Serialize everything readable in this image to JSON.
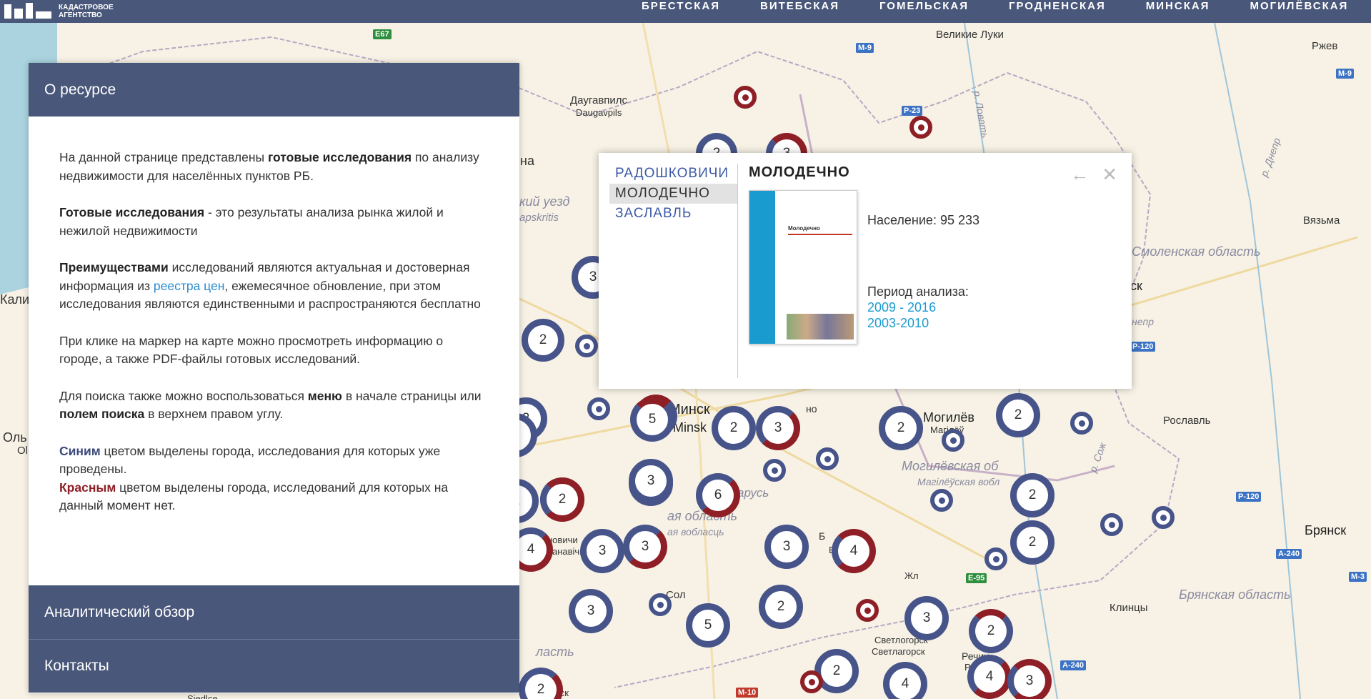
{
  "header": {
    "logo_text_line1": "КАДАСТРОВОЕ",
    "logo_text_line2": "АГЕНТСТВО",
    "nav": [
      "БРЕСТСКАЯ",
      "ВИТЕБСКАЯ",
      "ГОМЕЛЬСКАЯ",
      "ГРОДНЕНСКАЯ",
      "МИНСКАЯ",
      "МОГИЛЁВСКАЯ"
    ]
  },
  "panel": {
    "about_title": "О ресурсе",
    "p1_a": "На данной странице представлены ",
    "p1_b": "готовые исследования",
    "p1_c": " по анализу недвижимости для населённых пунктов РБ.",
    "p2_a": "Готовые исследования",
    "p2_b": " - это результаты анализа рынка жилой и нежилой недвижимости",
    "p3_a": "Преимуществами",
    "p3_b": " исследований являются актуальная и достоверная информация из ",
    "p3_link": "реестра цен",
    "p3_c": ", ежемесячное обновление, при этом исследования являются единственными и распространяются бесплатно",
    "p4": "При клике на маркер на карте можно просмотреть информацию о городе, а также PDF-файлы готовых исследований.",
    "p5_a": "Для поиска также можно воспользоваться ",
    "p5_b": "меню",
    "p5_c": " в начале страницы или ",
    "p5_d": "полем поиска",
    "p5_e": " в верхнем правом углу.",
    "p6_a": "Синим",
    "p6_b": " цветом выделены города, исследования для которых уже проведены.",
    "p6_c": "Красным",
    "p6_d": " цветом выделены города, исследований для которых на данный момент нет.",
    "analytics_title": "Аналитический обзор",
    "contacts_title": "Контакты"
  },
  "popup": {
    "cities": [
      "РАДОШКОВИЧИ",
      "МОЛОДЕЧНО",
      "ЗАСЛАВЛЬ"
    ],
    "active_city": "МОЛОДЕЧНО",
    "title": "МОЛОДЕЧНО",
    "doc_title": "Молодечно",
    "population": "Население: 95 233",
    "period_label": "Период анализа:",
    "periods": [
      "2009 - 2016",
      "2003-2010"
    ],
    "back_icon": "←",
    "close_icon": "✕"
  },
  "map": {
    "labels": {
      "velikie_luki": "Великие Луки",
      "rzhev": "Ржев",
      "daugavpils1": "Даугавпилс",
      "daugavpils2": "Daugavpils",
      "smolensk_obl": "Смоленская область",
      "vyazma": "Вязьма",
      "minsk1": "Минск",
      "minsk2": "Minsk",
      "mogilev1": "Могилёв",
      "mogilev2": "Магілёў",
      "mogilev_obl1": "Могилёвская об",
      "mogilev_obl2": "Магілёўская вобл",
      "roslavl": "Рославль",
      "bryansk": "Брянск",
      "bryansk_obl": "Брянская область",
      "klintsy": "Клинцы",
      "svetlogorsk1": "Светлогорск",
      "svetlogorsk2": "Светлагорск",
      "rechitsa1": "Речиц",
      "rechitsa2": "Рэчыц",
      "pinsk": "Пинск",
      "dnepr": "р. Днепр",
      "lovat": "р. Ловать",
      "sozh": "р. Сож",
      "belarus": "арусь",
      "minsk_obl1": "ая область",
      "minsk_obl2": "ая вобласць",
      "baranovichi1": "новичи",
      "baranovichi2": "Баранавічы",
      "uezd": "кий уезд",
      "apskritis": "apskritis",
      "na": "на",
      "kalin": "Калин",
      "olsh": "Оль",
      "ol": "Ol",
      "sk": "ск",
      "no": "но",
      "solig": "Сол",
      "zhl": "Жл",
      "nepr": "непр",
      "siedlce": "Siedlce",
      "brest_obl": "ласть",
      "bobr": "Б",
      "bobr2": "Ба"
    },
    "shields": [
      "E67",
      "M-9",
      "P-23",
      "M-9",
      "P-120",
      "P-120",
      "A-240",
      "M-3",
      "E-95",
      "M-10",
      "A-240"
    ],
    "clusters": [
      "2",
      "3",
      "3",
      "2",
      "2",
      "3",
      "2",
      "3",
      "5",
      "2",
      "3",
      "2",
      "2",
      "3",
      "6",
      "3",
      "2",
      "2",
      "4",
      "3",
      "3",
      "3",
      "4",
      "2",
      "2",
      "3",
      "5",
      "2",
      "3",
      "2",
      "4",
      "4",
      "3",
      "2",
      "2"
    ]
  }
}
